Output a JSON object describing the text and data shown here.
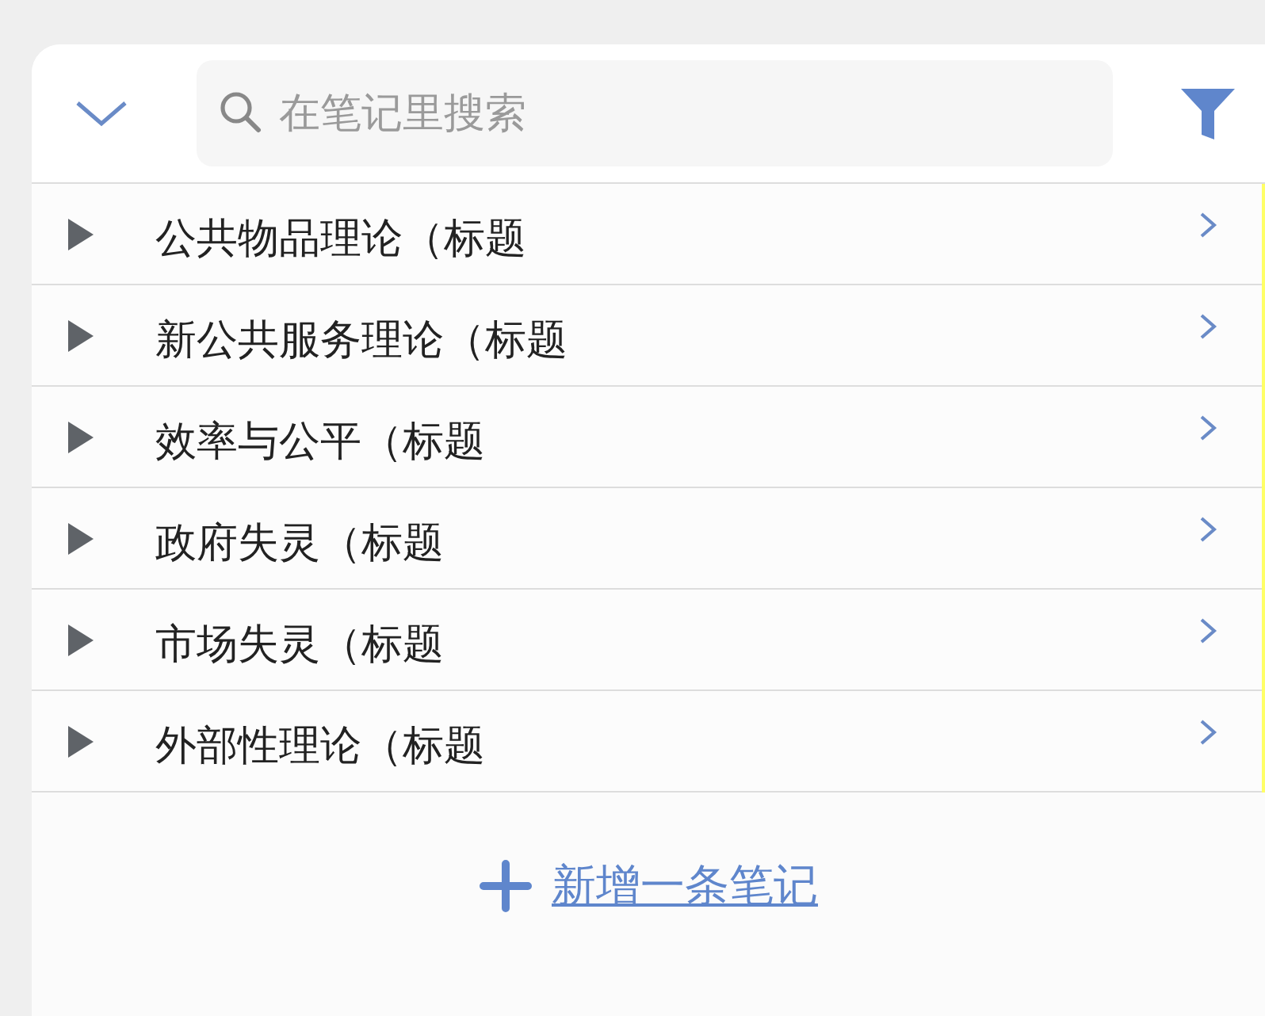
{
  "search": {
    "placeholder": "在笔记里搜索"
  },
  "notes": [
    {
      "title": "公共物品理论（标题",
      "expanded": false
    },
    {
      "title": "新公共服务理论（标题",
      "expanded": false
    },
    {
      "title": "效率与公平（标题",
      "expanded": false
    },
    {
      "title": "政府失灵（标题",
      "expanded": false
    },
    {
      "title": "市场失灵（标题",
      "expanded": false
    },
    {
      "title": "外部性理论（标题",
      "expanded": false
    }
  ],
  "add_note": "新增一条笔记"
}
